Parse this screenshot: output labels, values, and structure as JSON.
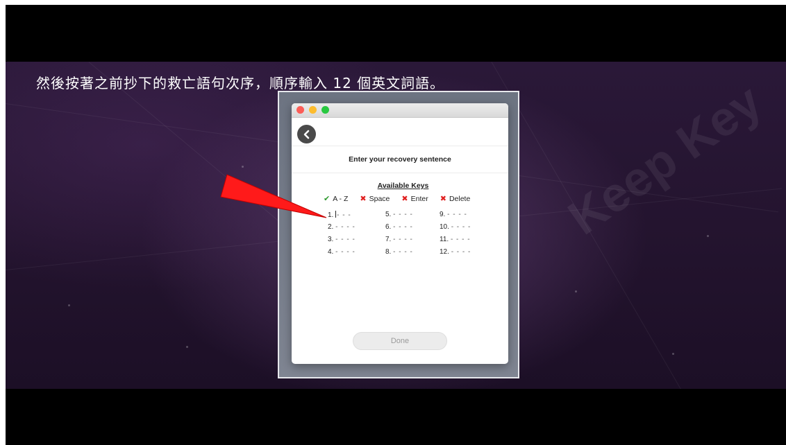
{
  "caption": "然後按著之前抄下的救亡語句次序，順序輸入 12 個英文詞語。",
  "watermark": "Keep Key",
  "window": {
    "heading": "Enter your recovery sentence",
    "keys_title": "Available Keys",
    "keys": [
      {
        "label": "A - Z",
        "allowed": true
      },
      {
        "label": "Space",
        "allowed": false
      },
      {
        "label": "Enter",
        "allowed": false
      },
      {
        "label": "Delete",
        "allowed": false
      }
    ],
    "words": [
      {
        "num": "1.",
        "value": "- - -"
      },
      {
        "num": "2.",
        "value": "- - - -"
      },
      {
        "num": "3.",
        "value": "- - - -"
      },
      {
        "num": "4.",
        "value": "- - - -"
      },
      {
        "num": "5.",
        "value": "- - - -"
      },
      {
        "num": "6.",
        "value": "- - - -"
      },
      {
        "num": "7.",
        "value": "- - - -"
      },
      {
        "num": "8.",
        "value": "- - - -"
      },
      {
        "num": "9.",
        "value": "- - - -"
      },
      {
        "num": "10.",
        "value": "- - - -"
      },
      {
        "num": "11.",
        "value": "- - - -"
      },
      {
        "num": "12.",
        "value": "- - - -"
      }
    ],
    "done_label": "Done"
  },
  "colors": {
    "allowed": "#2e9a2e",
    "disallowed": "#e02020",
    "arrow": "#ff1a1a"
  }
}
